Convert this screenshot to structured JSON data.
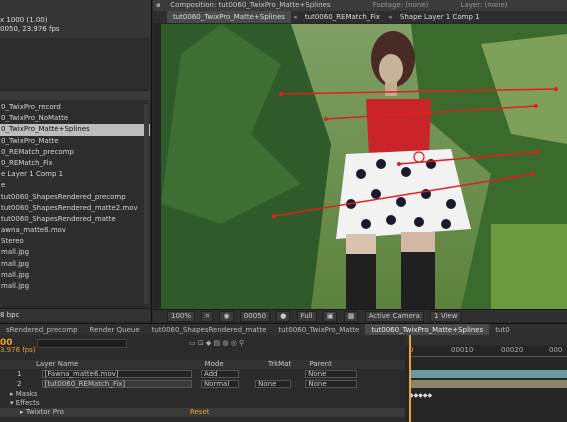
{
  "project": {
    "info_lines": [
      "x 1000 (1.00)",
      "0050, 23.976 fps"
    ],
    "items": [
      {
        "label": "0_TwixPro_record",
        "selected": false
      },
      {
        "label": "0_TwixPro_NoMatte",
        "selected": false
      },
      {
        "label": "0_TwixPro_Matte+Splines",
        "selected": true
      },
      {
        "label": "0_TwixPro_Matte",
        "selected": false
      },
      {
        "label": "0_REMatch_precomp",
        "selected": false
      },
      {
        "label": "0_REMatch_Fix",
        "selected": false
      },
      {
        "label": "e Layer 1 Comp 1",
        "selected": false
      },
      {
        "label": "e",
        "selected": false
      },
      {
        "label": "tut0060_ShapesRendered_precomp",
        "selected": false
      },
      {
        "label": "tut0060_ShapesRendered_matte2.mov",
        "selected": false
      },
      {
        "label": "tut0060_ShapesRendered_matte",
        "selected": false
      },
      {
        "label": "awna_matte6.mov",
        "selected": false
      },
      {
        "label": "Stereo",
        "selected": false
      },
      {
        "label": "mall.jpg",
        "selected": false
      },
      {
        "label": "mall.jpg",
        "selected": false
      },
      {
        "label": "mall.jpg",
        "selected": false
      },
      {
        "label": "mall.jpg",
        "selected": false
      }
    ],
    "footer": "8 bpc"
  },
  "comp": {
    "header": {
      "composition": "Composition: tut0060_TwixPro_Matte+Splines",
      "footage": "Footage: (none)",
      "layer": "Layer: (none)"
    },
    "tabs": [
      "tut0060_TwixPro_Matte+Splines",
      "tut0060_REMatch_Fix",
      "Shape Layer 1 Comp 1"
    ],
    "viewer_bar": {
      "zoom": "100%",
      "timecode": "00050",
      "resolution": "Full",
      "camera": "Active Camera",
      "view": "1 View"
    }
  },
  "panel_tabs": [
    {
      "label": "sRendered_precomp",
      "active": false
    },
    {
      "label": "Render Queue",
      "active": false
    },
    {
      "label": "tut0060_ShapesRendered_matte",
      "active": false
    },
    {
      "label": "tut0060_TwixPro_Matte",
      "active": false
    },
    {
      "label": "tut0060_TwixPro_Matte+Splines",
      "active": true
    },
    {
      "label": "tut0",
      "active": false
    }
  ],
  "timeline": {
    "timecode": "00",
    "fps": "3.976 fps)",
    "col_layer_name": "Layer Name",
    "col_mode": "Mode",
    "col_trkmat": "TrkMat",
    "col_parent": "Parent",
    "layers": [
      {
        "num": "1",
        "name": "[Fawna_matte6.mov]",
        "mode": "Add",
        "trkmat": "",
        "parent": "None"
      },
      {
        "num": "2",
        "name": "[tut0060_REMatch_Fix]",
        "mode": "Normal",
        "trkmat": "None",
        "parent": "None"
      }
    ],
    "prop_masks": "Masks",
    "prop_effects": "Effects",
    "prop_effect": "Twixtor Pro",
    "prop_reset": "Reset",
    "ruler_ticks": [
      "00010",
      "00020",
      "000"
    ],
    "ruler_start": "0"
  }
}
